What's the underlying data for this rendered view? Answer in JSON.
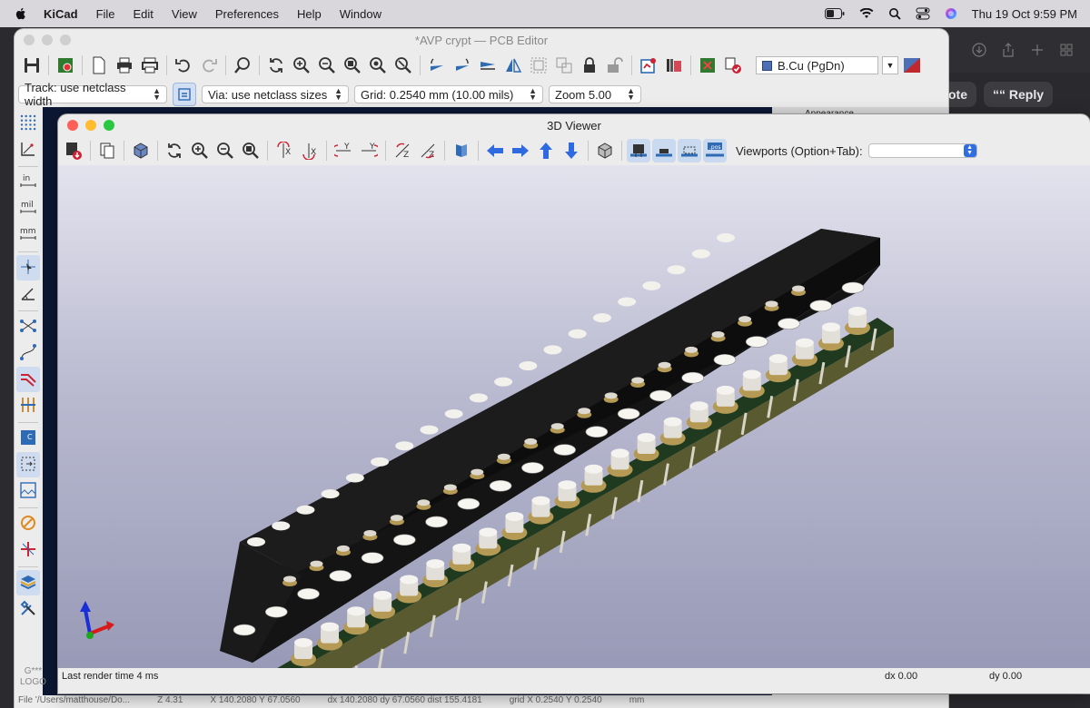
{
  "menubar": {
    "app": "KiCad",
    "items": [
      "File",
      "Edit",
      "View",
      "Preferences",
      "Help",
      "Window"
    ],
    "clock": "Thu 19 Oct  9:59 PM"
  },
  "background_window": {
    "quote_label": "ote",
    "reply_label": "Reply"
  },
  "pcb_editor": {
    "title": "*AVP crypt — PCB Editor",
    "layer": {
      "name": "B.Cu (PgDn)",
      "color": "#4c6fb5"
    },
    "track": "Track: use netclass width",
    "via": "Via: use netclass sizes",
    "grid": "Grid: 0.2540 mm (10.00 mils)",
    "zoom": "Zoom 5.00",
    "appearance_header": "Appearance",
    "status": {
      "file": "File '/Users/matthouse/Do...",
      "z": "Z 4.31",
      "xy": "X 140.2080  Y 67.0560",
      "dxy": "dx 140.2080  dy 67.0560  dist 155.4181",
      "grid": "grid X 0.2540  Y 0.2540",
      "units": "mm"
    },
    "logo_note_a": "G***",
    "logo_note_b": "LOGO",
    "left_tools": [
      "grid-dots-icon",
      "polar-coords-icon",
      "inch-units-icon",
      "mil-units-icon",
      "mm-units-icon",
      "cursor-snap-icon",
      "angle-constraint-icon",
      "ratsnest-icon",
      "curved-ratsnest-icon",
      "tracks-high-contrast-icon",
      "vias-icon",
      "pad-numbers-icon",
      "outline-icon",
      "zones-icon",
      "drc-marker-icon",
      "net-inspector-icon",
      "layers-manager-icon",
      "tools-icon"
    ]
  },
  "viewer3d": {
    "title": "3D Viewer",
    "viewports_label": "Viewports (Option+Tab):",
    "viewports_value": "",
    "status": {
      "render_time": "Last render time 4 ms",
      "dx": "dx 0.00",
      "dy": "dy 0.00"
    },
    "colors": {
      "bg_top": "#e3e3ee",
      "bg_bottom": "#9799b6",
      "socket_body": "#1c1c1c",
      "pcb_green": "#1f3a1e",
      "pad_gold": "#b49a54",
      "pin": "#d8d4c8"
    }
  }
}
